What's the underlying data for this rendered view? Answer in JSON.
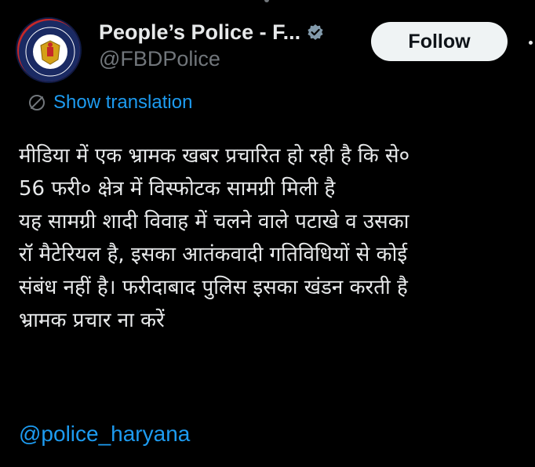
{
  "account": {
    "display_name": "People’s Police - F...",
    "handle": "@FBDPolice",
    "verified": true,
    "verified_color": "#829aab"
  },
  "follow": {
    "label": "Follow"
  },
  "translation": {
    "label": "Show translation",
    "icon": "globe-icon"
  },
  "tweet": {
    "lines": [
      "मीडिया में एक भ्रामक खबर प्रचारित हो रही है कि से०",
      "56 फरी० क्षेत्र में विस्फोटक सामग्री मिली है",
      "यह सामग्री शादी विवाह में चलने वाले पटाखे व उसका",
      "रॉ मैटेरियल है, इसका आतंकवादी गतिविधियों से कोई",
      "संबंध नहीं है। फरीदाबाद पुलिस इसका खंडन करती है",
      "भ्रामक प्रचार ना करें"
    ],
    "mention": "@police_haryana"
  },
  "colors": {
    "background": "#000000",
    "text": "#e7e9ea",
    "secondary": "#71767b",
    "link": "#1d9bf0",
    "button_bg": "#eff3f4"
  }
}
